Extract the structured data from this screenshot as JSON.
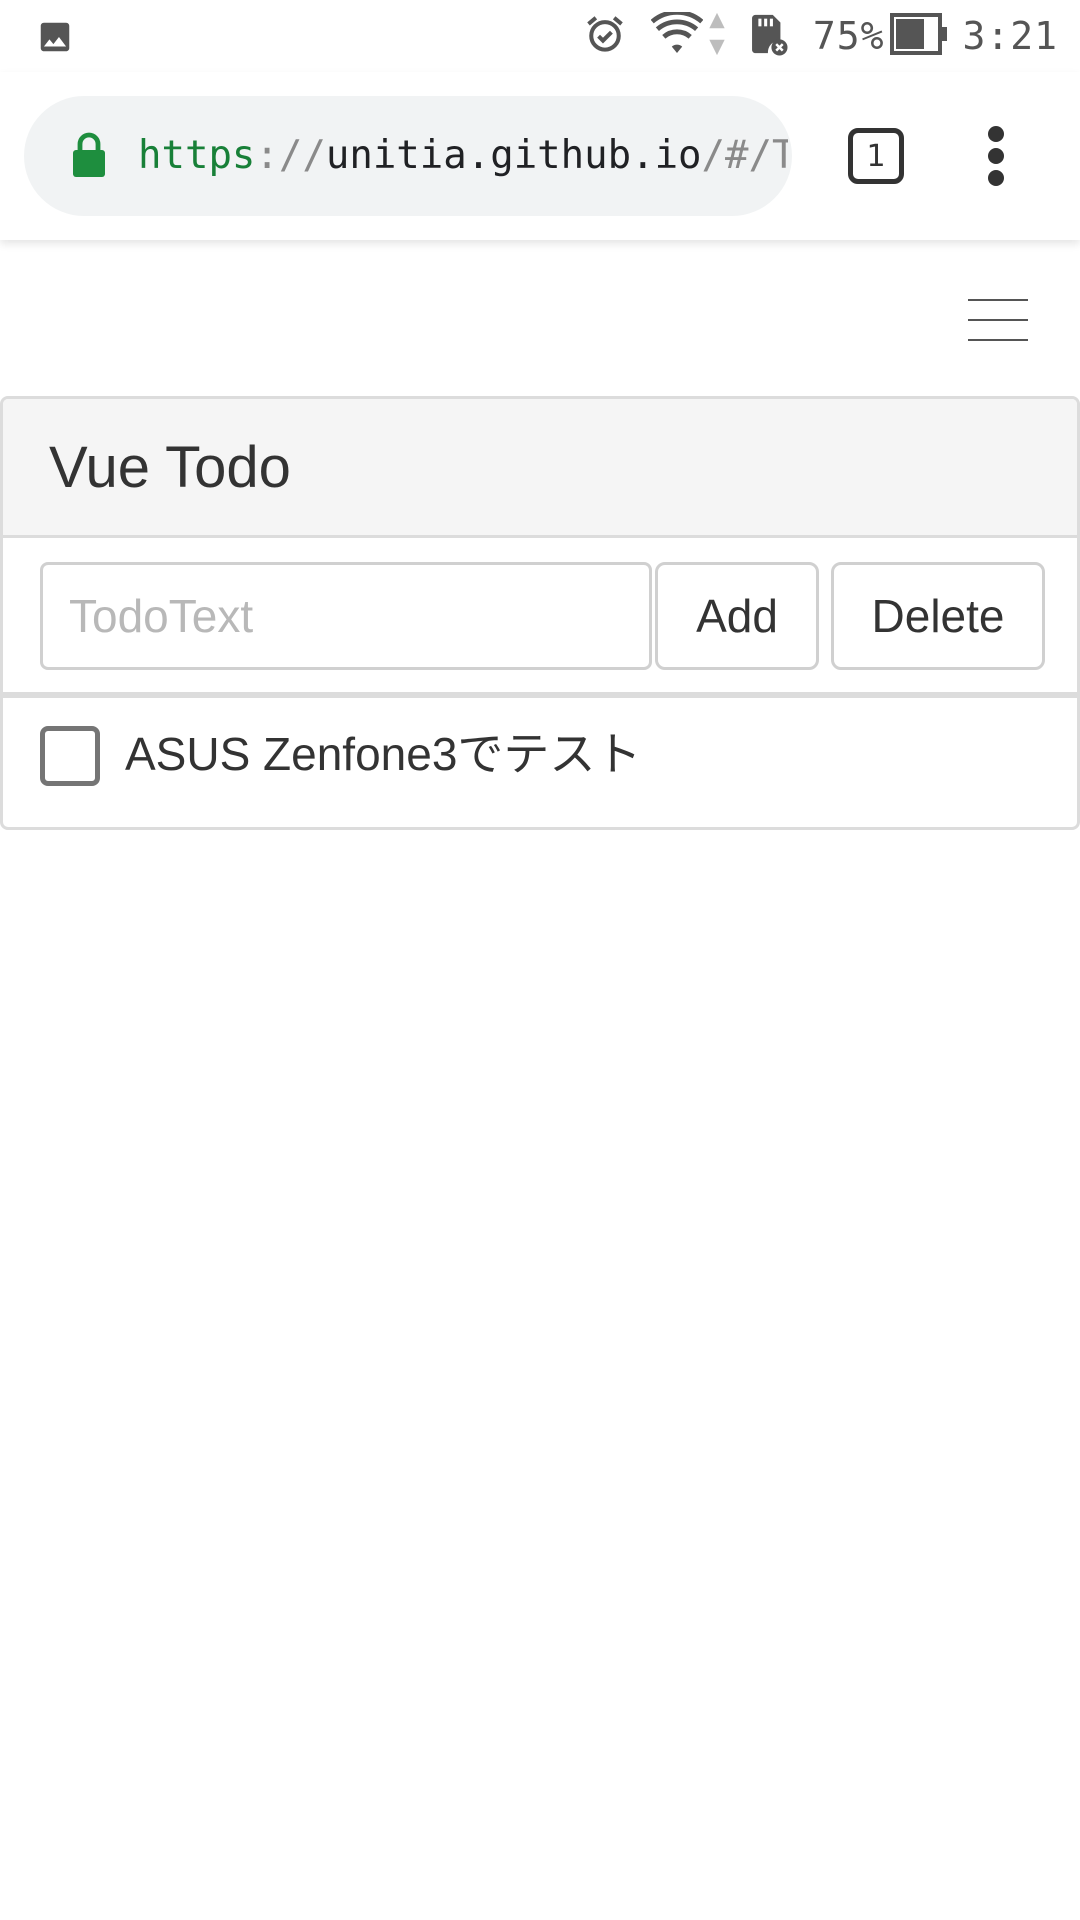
{
  "status_bar": {
    "left_icon": "image-icon",
    "battery_percent": "75%",
    "time": "3:21",
    "icons": [
      "alarm-icon",
      "wifi-icon",
      "data-arrows-icon",
      "sd-card-icon",
      "battery-icon"
    ]
  },
  "browser": {
    "url_scheme": "https",
    "url_separator": "://",
    "url_host": "unitia.github.io",
    "url_path": "/#/Tod",
    "tab_count": "1",
    "lock_color": "#1e8e3e"
  },
  "app": {
    "title": "Vue Todo",
    "input_placeholder": "TodoText",
    "input_value": "",
    "add_label": "Add",
    "delete_label": "Delete",
    "todos": [
      {
        "text": "ASUS Zenfone3でテスト",
        "checked": false
      }
    ]
  }
}
